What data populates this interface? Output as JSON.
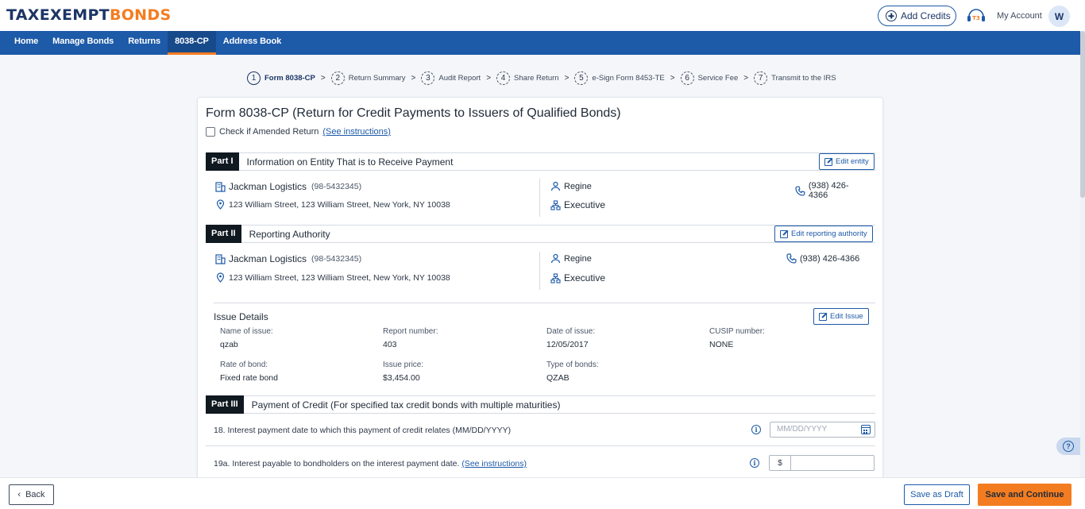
{
  "header": {
    "logo_main": "TAXEXEMPT",
    "logo_accent": "BONDS",
    "add_credits_label": "Add Credits",
    "my_account_label": "My Account",
    "avatar_initial": "W"
  },
  "nav": {
    "items": [
      "Home",
      "Manage Bonds",
      "Returns",
      "8038-CP",
      "Address Book"
    ],
    "active": "8038-CP"
  },
  "stepper": {
    "steps": [
      {
        "num": "1",
        "label": "Form 8038-CP"
      },
      {
        "num": "2",
        "label": "Return Summary"
      },
      {
        "num": "3",
        "label": "Audit Report"
      },
      {
        "num": "4",
        "label": "Share Return"
      },
      {
        "num": "5",
        "label": "e-Sign Form 8453-TE"
      },
      {
        "num": "6",
        "label": "Service Fee"
      },
      {
        "num": "7",
        "label": "Transmit to the IRS"
      }
    ],
    "separator": ">"
  },
  "form": {
    "title": "Form 8038-CP (Return for Credit Payments to Issuers of Qualified Bonds)",
    "amended_label": "Check if Amended Return",
    "amended_link": "(See instructions)",
    "amended_checked": false
  },
  "part1": {
    "tag": "Part I",
    "title": "Information on Entity That is to Receive Payment",
    "edit_label": "Edit entity",
    "entity_name": "Jackman Logistics",
    "ein": "(98-5432345)",
    "address": "123 William Street, 123 William Street, New York, NY 10038",
    "contact_name": "Regine",
    "contact_title": "Executive",
    "phone": "(938) 426-4366"
  },
  "part2": {
    "tag": "Part II",
    "title": "Reporting Authority",
    "edit_label": "Edit reporting authority",
    "entity_name": "Jackman Logistics",
    "ein": "(98-5432345)",
    "address": "123 William Street, 123 William Street, New York, NY 10038",
    "contact_name": "Regine",
    "contact_title": "Executive",
    "phone": "(938) 426-4366"
  },
  "issue": {
    "title": "Issue Details",
    "edit_label": "Edit Issue",
    "name_label": "Name of issue:",
    "name_value": "qzab",
    "report_label": "Report number:",
    "report_value": "403",
    "date_label": "Date of issue:",
    "date_value": "12/05/2017",
    "cusip_label": "CUSIP number:",
    "cusip_value": "NONE",
    "rate_label": "Rate of bond:",
    "rate_value": "Fixed rate bond",
    "price_label": "Issue price:",
    "price_value": "$3,454.00",
    "type_label": "Type of bonds:",
    "type_value": "QZAB"
  },
  "part3": {
    "tag": "Part III",
    "title": "Payment of Credit (For specified tax credit bonds with multiple maturities)",
    "q18_text": "18. Interest payment date to which this payment of credit relates (MM/DD/YYYY)",
    "q18_placeholder": "MM/DD/YYYY",
    "q19a_text": "19a. Interest payable to bondholders on the interest payment date.",
    "q19a_link": "(See instructions)",
    "currency_symbol": "$"
  },
  "footer": {
    "back_label": "Back",
    "draft_label": "Save as Draft",
    "continue_label": "Save and Continue"
  },
  "colors": {
    "brand_blue": "#1d5aa8",
    "brand_orange": "#f47c20",
    "navy": "#1c3566"
  }
}
